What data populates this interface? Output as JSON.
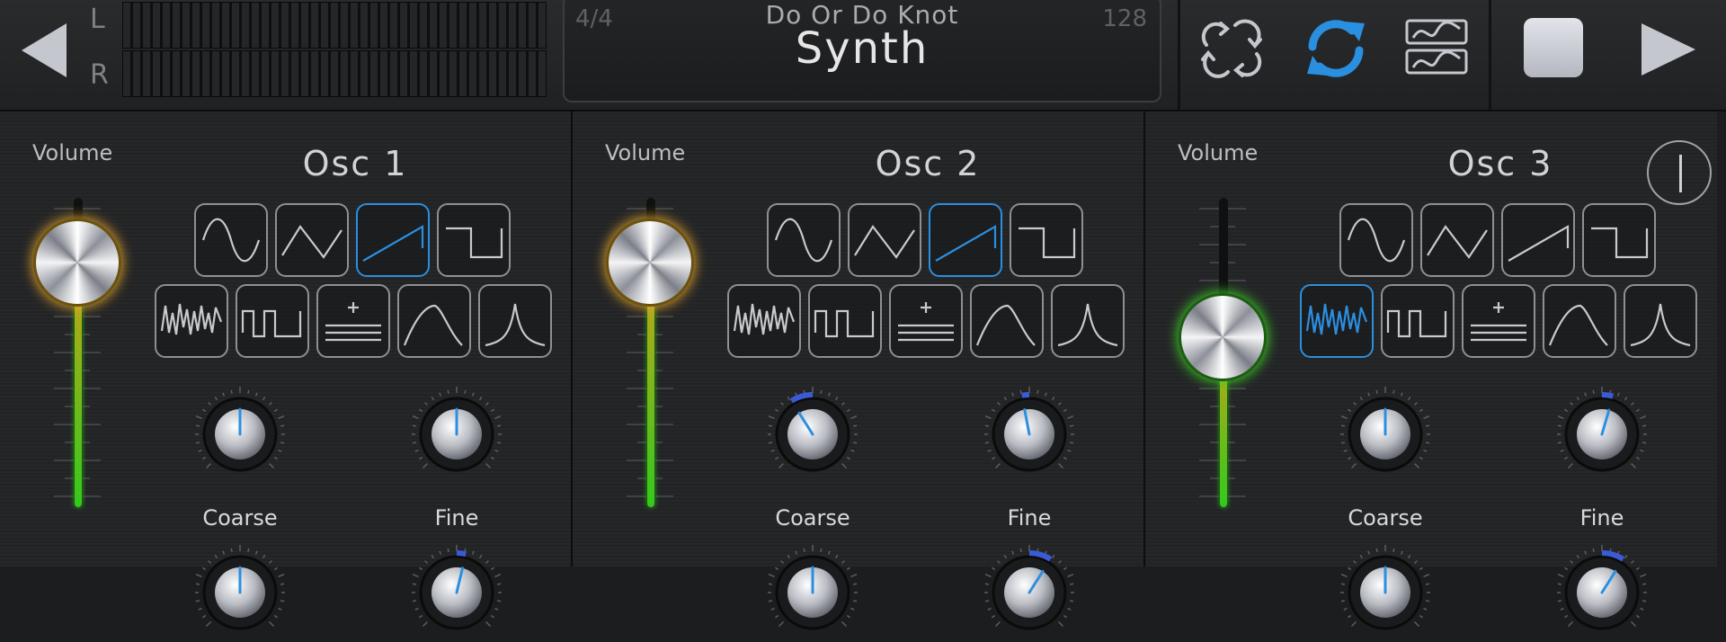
{
  "meter": {
    "left_label": "L",
    "right_label": "R"
  },
  "display": {
    "time_signature": "4/4",
    "tempo": "128",
    "song_name": "Do Or Do Knot",
    "patch_name": "Synth"
  },
  "colors": {
    "accent_blue": "#2b8fe0",
    "knob_glow_amber": "#e1a42a",
    "knob_glow_green": "#3fd226",
    "fader_green": "#33c91c"
  },
  "toolbar": {
    "icons": [
      "back-arrow-icon",
      "loop-arrows-icon",
      "sync-refresh-icon",
      "waveform-monitor-icon",
      "stop-icon",
      "play-icon"
    ],
    "sync_active": true
  },
  "oscillators": [
    {
      "title": "Osc 1",
      "volume_label": "Volume",
      "volume": 0.79,
      "waveform": "saw",
      "coarse_label": "Coarse",
      "fine_label": "Fine",
      "coarse": 0.5,
      "fine": 0.5
    },
    {
      "title": "Osc 2",
      "volume_label": "Volume",
      "volume": 0.79,
      "waveform": "saw",
      "coarse_label": "Coarse",
      "fine_label": "Fine",
      "coarse": 0.38,
      "fine": 0.46
    },
    {
      "title": "Osc 3",
      "volume_label": "Volume",
      "volume": 0.55,
      "waveform": "noise",
      "coarse_label": "Coarse",
      "fine_label": "Fine",
      "coarse": 0.5,
      "fine": 0.56
    }
  ]
}
